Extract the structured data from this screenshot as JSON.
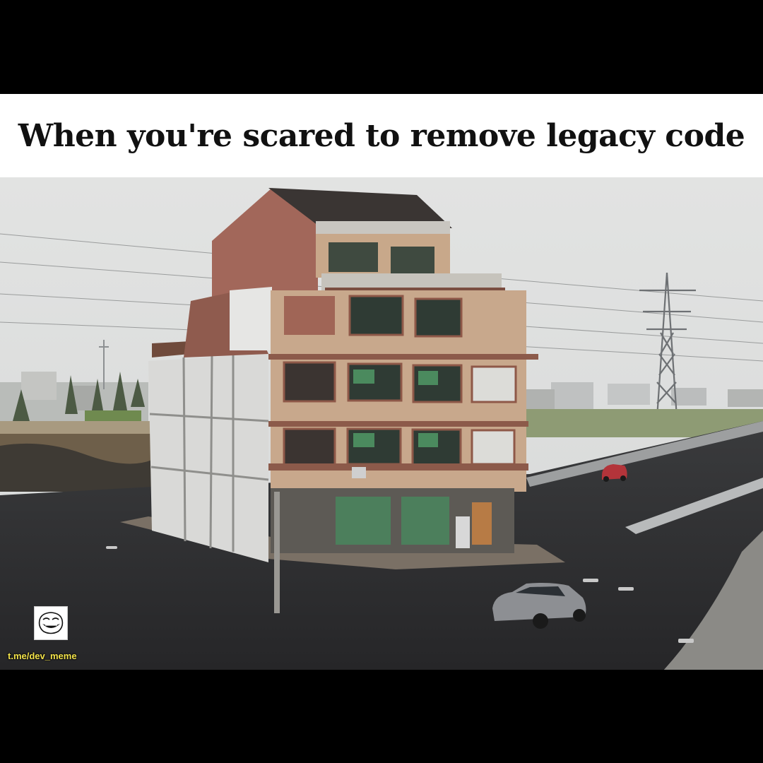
{
  "caption": "When you're scared to remove legacy code",
  "watermark": "t.me/dev_meme",
  "icons": {
    "logo": "troll-face-icon"
  },
  "colors": {
    "frame": "#000000",
    "caption_bg": "#ffffff",
    "caption_text": "#111111",
    "watermark": "#f2e24a",
    "sky": "#dfe0df",
    "asphalt": "#2f2f31"
  }
}
